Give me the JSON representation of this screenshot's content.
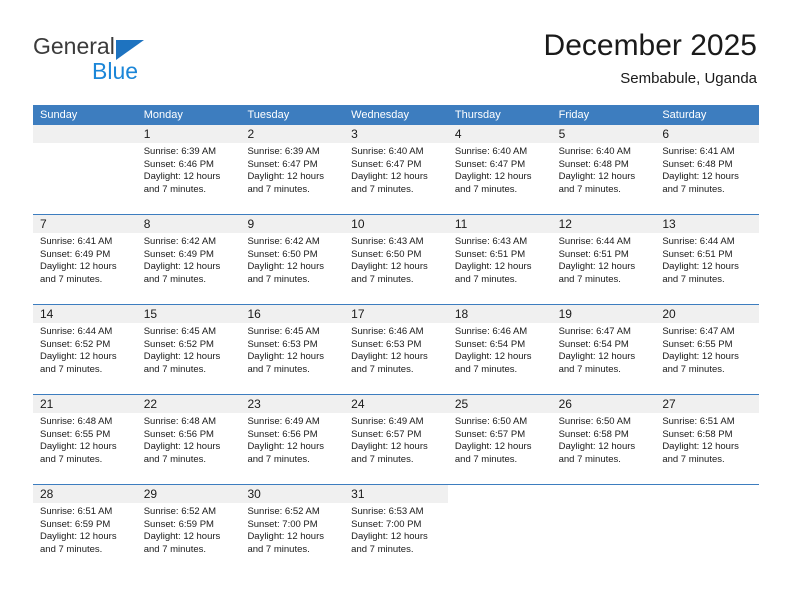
{
  "brand": {
    "name_top": "General",
    "name_bottom": "Blue"
  },
  "header": {
    "title": "December 2025",
    "subtitle": "Sembabule, Uganda"
  },
  "colors": {
    "header_blue": "#3d7dbf",
    "logo_blue": "#1b86d8",
    "logo_triangle": "#1e73c0",
    "day_band_gray": "#f0f0f0",
    "text": "#1a1a1a"
  },
  "labels": {
    "sunrise_prefix": "Sunrise:",
    "sunset_prefix": "Sunset:",
    "daylight_prefix": "Daylight:"
  },
  "weekdays": [
    "Sunday",
    "Monday",
    "Tuesday",
    "Wednesday",
    "Thursday",
    "Friday",
    "Saturday"
  ],
  "weeks": [
    [
      {
        "empty": true
      },
      {
        "day": "1",
        "sunrise": "Sunrise: 6:39 AM",
        "sunset": "Sunset: 6:46 PM",
        "daylight_1": "Daylight: 12 hours",
        "daylight_2": "and 7 minutes."
      },
      {
        "day": "2",
        "sunrise": "Sunrise: 6:39 AM",
        "sunset": "Sunset: 6:47 PM",
        "daylight_1": "Daylight: 12 hours",
        "daylight_2": "and 7 minutes."
      },
      {
        "day": "3",
        "sunrise": "Sunrise: 6:40 AM",
        "sunset": "Sunset: 6:47 PM",
        "daylight_1": "Daylight: 12 hours",
        "daylight_2": "and 7 minutes."
      },
      {
        "day": "4",
        "sunrise": "Sunrise: 6:40 AM",
        "sunset": "Sunset: 6:47 PM",
        "daylight_1": "Daylight: 12 hours",
        "daylight_2": "and 7 minutes."
      },
      {
        "day": "5",
        "sunrise": "Sunrise: 6:40 AM",
        "sunset": "Sunset: 6:48 PM",
        "daylight_1": "Daylight: 12 hours",
        "daylight_2": "and 7 minutes."
      },
      {
        "day": "6",
        "sunrise": "Sunrise: 6:41 AM",
        "sunset": "Sunset: 6:48 PM",
        "daylight_1": "Daylight: 12 hours",
        "daylight_2": "and 7 minutes."
      }
    ],
    [
      {
        "day": "7",
        "sunrise": "Sunrise: 6:41 AM",
        "sunset": "Sunset: 6:49 PM",
        "daylight_1": "Daylight: 12 hours",
        "daylight_2": "and 7 minutes."
      },
      {
        "day": "8",
        "sunrise": "Sunrise: 6:42 AM",
        "sunset": "Sunset: 6:49 PM",
        "daylight_1": "Daylight: 12 hours",
        "daylight_2": "and 7 minutes."
      },
      {
        "day": "9",
        "sunrise": "Sunrise: 6:42 AM",
        "sunset": "Sunset: 6:50 PM",
        "daylight_1": "Daylight: 12 hours",
        "daylight_2": "and 7 minutes."
      },
      {
        "day": "10",
        "sunrise": "Sunrise: 6:43 AM",
        "sunset": "Sunset: 6:50 PM",
        "daylight_1": "Daylight: 12 hours",
        "daylight_2": "and 7 minutes."
      },
      {
        "day": "11",
        "sunrise": "Sunrise: 6:43 AM",
        "sunset": "Sunset: 6:51 PM",
        "daylight_1": "Daylight: 12 hours",
        "daylight_2": "and 7 minutes."
      },
      {
        "day": "12",
        "sunrise": "Sunrise: 6:44 AM",
        "sunset": "Sunset: 6:51 PM",
        "daylight_1": "Daylight: 12 hours",
        "daylight_2": "and 7 minutes."
      },
      {
        "day": "13",
        "sunrise": "Sunrise: 6:44 AM",
        "sunset": "Sunset: 6:51 PM",
        "daylight_1": "Daylight: 12 hours",
        "daylight_2": "and 7 minutes."
      }
    ],
    [
      {
        "day": "14",
        "sunrise": "Sunrise: 6:44 AM",
        "sunset": "Sunset: 6:52 PM",
        "daylight_1": "Daylight: 12 hours",
        "daylight_2": "and 7 minutes."
      },
      {
        "day": "15",
        "sunrise": "Sunrise: 6:45 AM",
        "sunset": "Sunset: 6:52 PM",
        "daylight_1": "Daylight: 12 hours",
        "daylight_2": "and 7 minutes."
      },
      {
        "day": "16",
        "sunrise": "Sunrise: 6:45 AM",
        "sunset": "Sunset: 6:53 PM",
        "daylight_1": "Daylight: 12 hours",
        "daylight_2": "and 7 minutes."
      },
      {
        "day": "17",
        "sunrise": "Sunrise: 6:46 AM",
        "sunset": "Sunset: 6:53 PM",
        "daylight_1": "Daylight: 12 hours",
        "daylight_2": "and 7 minutes."
      },
      {
        "day": "18",
        "sunrise": "Sunrise: 6:46 AM",
        "sunset": "Sunset: 6:54 PM",
        "daylight_1": "Daylight: 12 hours",
        "daylight_2": "and 7 minutes."
      },
      {
        "day": "19",
        "sunrise": "Sunrise: 6:47 AM",
        "sunset": "Sunset: 6:54 PM",
        "daylight_1": "Daylight: 12 hours",
        "daylight_2": "and 7 minutes."
      },
      {
        "day": "20",
        "sunrise": "Sunrise: 6:47 AM",
        "sunset": "Sunset: 6:55 PM",
        "daylight_1": "Daylight: 12 hours",
        "daylight_2": "and 7 minutes."
      }
    ],
    [
      {
        "day": "21",
        "sunrise": "Sunrise: 6:48 AM",
        "sunset": "Sunset: 6:55 PM",
        "daylight_1": "Daylight: 12 hours",
        "daylight_2": "and 7 minutes."
      },
      {
        "day": "22",
        "sunrise": "Sunrise: 6:48 AM",
        "sunset": "Sunset: 6:56 PM",
        "daylight_1": "Daylight: 12 hours",
        "daylight_2": "and 7 minutes."
      },
      {
        "day": "23",
        "sunrise": "Sunrise: 6:49 AM",
        "sunset": "Sunset: 6:56 PM",
        "daylight_1": "Daylight: 12 hours",
        "daylight_2": "and 7 minutes."
      },
      {
        "day": "24",
        "sunrise": "Sunrise: 6:49 AM",
        "sunset": "Sunset: 6:57 PM",
        "daylight_1": "Daylight: 12 hours",
        "daylight_2": "and 7 minutes."
      },
      {
        "day": "25",
        "sunrise": "Sunrise: 6:50 AM",
        "sunset": "Sunset: 6:57 PM",
        "daylight_1": "Daylight: 12 hours",
        "daylight_2": "and 7 minutes."
      },
      {
        "day": "26",
        "sunrise": "Sunrise: 6:50 AM",
        "sunset": "Sunset: 6:58 PM",
        "daylight_1": "Daylight: 12 hours",
        "daylight_2": "and 7 minutes."
      },
      {
        "day": "27",
        "sunrise": "Sunrise: 6:51 AM",
        "sunset": "Sunset: 6:58 PM",
        "daylight_1": "Daylight: 12 hours",
        "daylight_2": "and 7 minutes."
      }
    ],
    [
      {
        "day": "28",
        "sunrise": "Sunrise: 6:51 AM",
        "sunset": "Sunset: 6:59 PM",
        "daylight_1": "Daylight: 12 hours",
        "daylight_2": "and 7 minutes."
      },
      {
        "day": "29",
        "sunrise": "Sunrise: 6:52 AM",
        "sunset": "Sunset: 6:59 PM",
        "daylight_1": "Daylight: 12 hours",
        "daylight_2": "and 7 minutes."
      },
      {
        "day": "30",
        "sunrise": "Sunrise: 6:52 AM",
        "sunset": "Sunset: 7:00 PM",
        "daylight_1": "Daylight: 12 hours",
        "daylight_2": "and 7 minutes."
      },
      {
        "day": "31",
        "sunrise": "Sunrise: 6:53 AM",
        "sunset": "Sunset: 7:00 PM",
        "daylight_1": "Daylight: 12 hours",
        "daylight_2": "and 7 minutes."
      },
      {
        "empty": true,
        "blank": true
      },
      {
        "empty": true,
        "blank": true
      },
      {
        "empty": true,
        "blank": true
      }
    ]
  ]
}
